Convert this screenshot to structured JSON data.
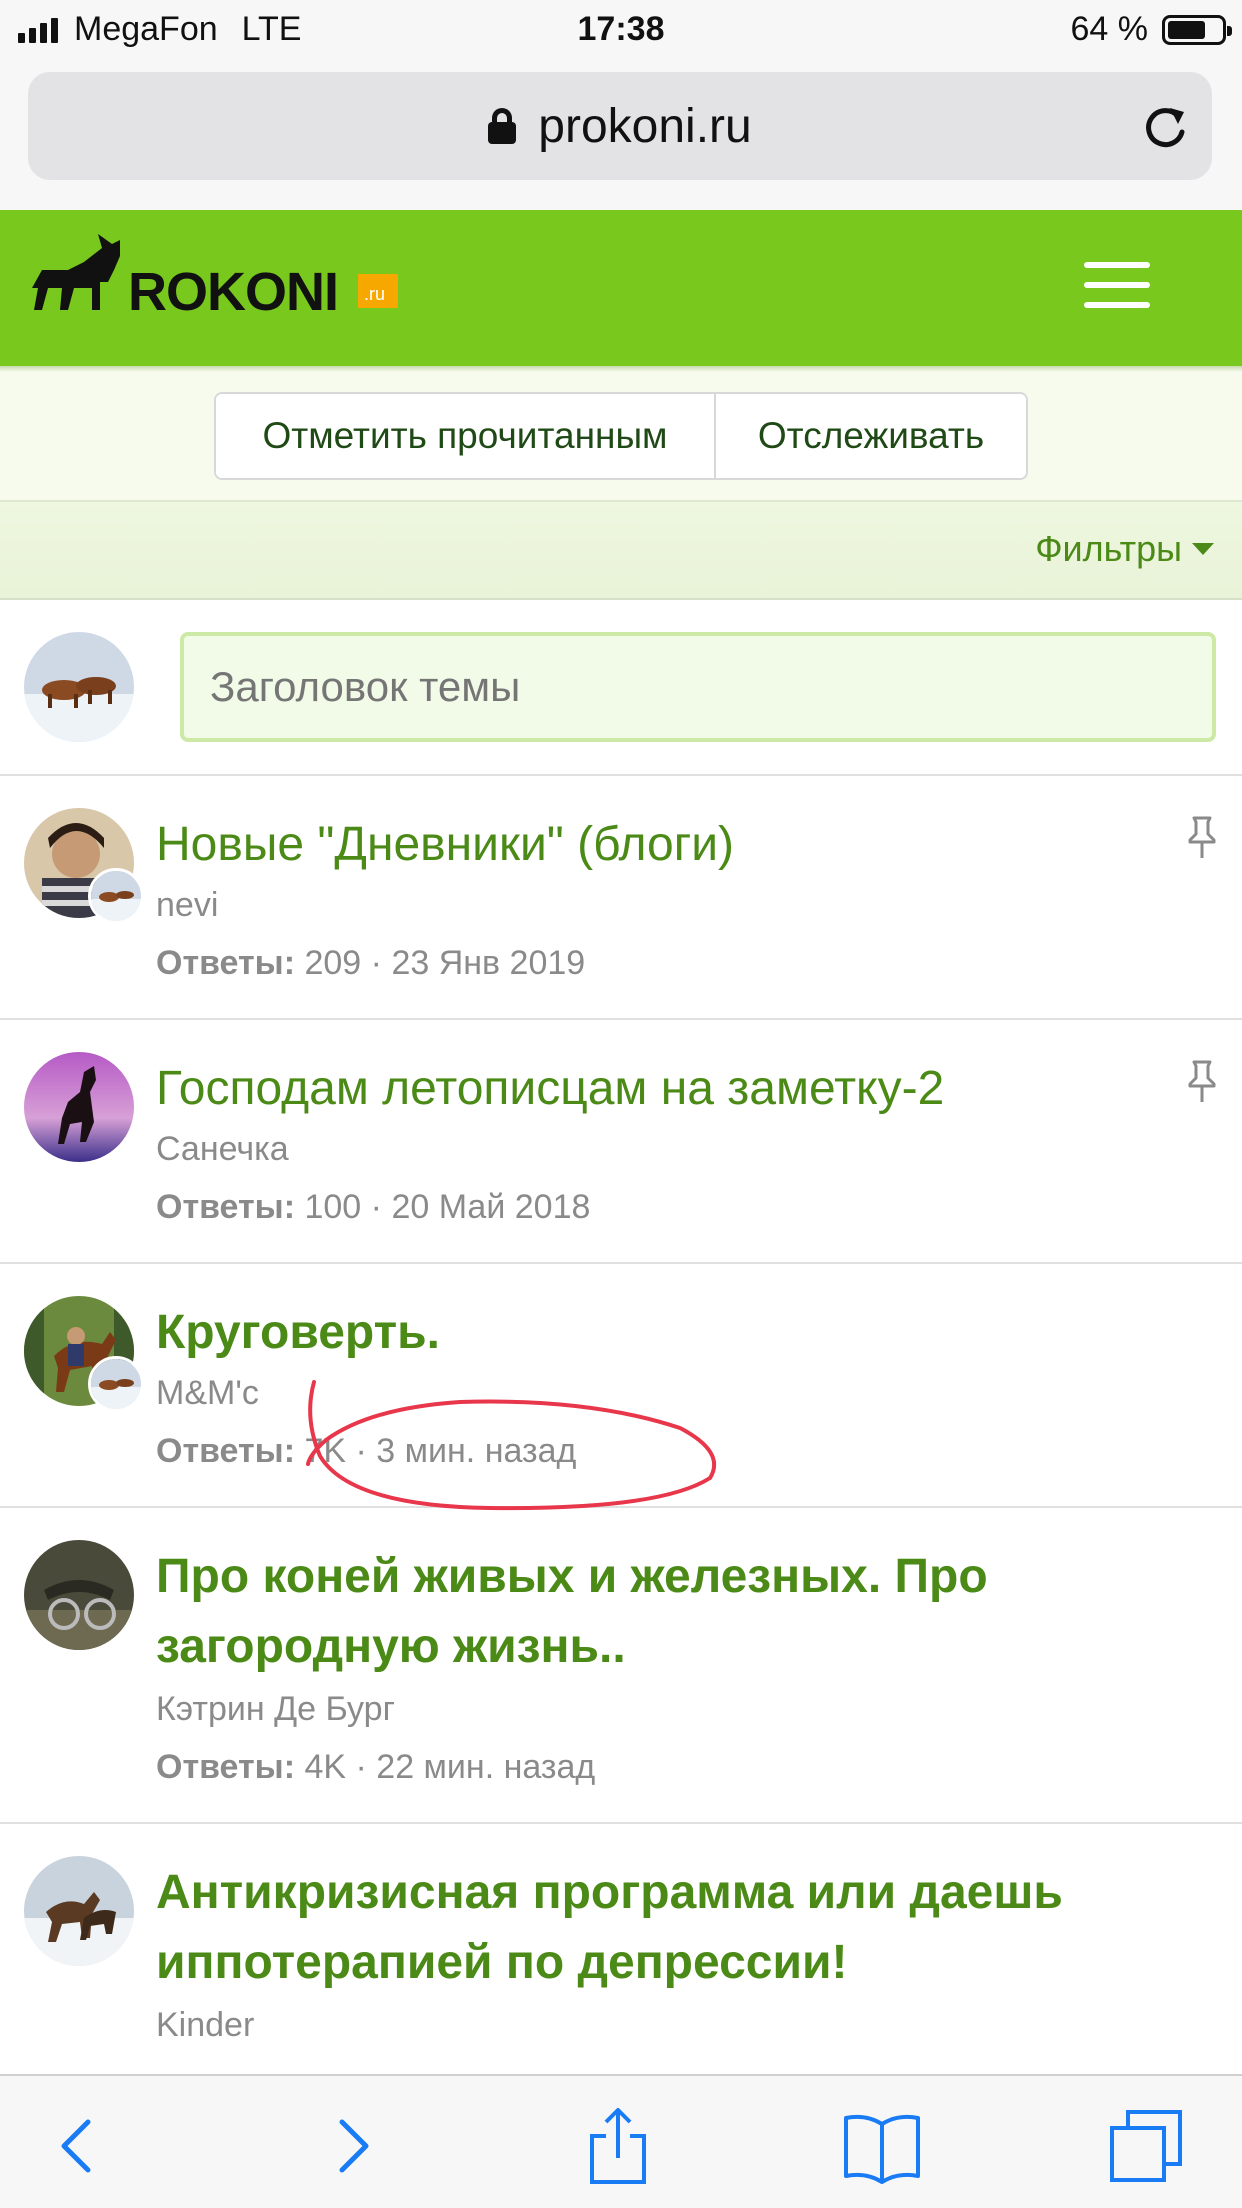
{
  "status_bar": {
    "carrier": "MegaFon",
    "network": "LTE",
    "time": "17:38",
    "battery": "64 %",
    "battery_level": 0.64
  },
  "browser": {
    "url": "prokoni.ru"
  },
  "site": {
    "logo_alt": "PROKONI.ru",
    "brand_color": "#78c81e"
  },
  "actions": {
    "mark_read": "Отметить прочитанным",
    "watch": "Отслеживать"
  },
  "filters": {
    "label": "Фильтры"
  },
  "new_thread": {
    "placeholder": "Заголовок темы"
  },
  "threads": [
    {
      "title": "Новые \"Дневники\" (блоги)",
      "author": "nevi",
      "replies_label": "Ответы:",
      "replies": "209",
      "date": "23 Янв 2019",
      "pinned": true,
      "unread": false
    },
    {
      "title": "Господам летописцам на заметку-2",
      "author": "Санечка",
      "replies_label": "Ответы:",
      "replies": "100",
      "date": "20 Май 2018",
      "pinned": true,
      "unread": false
    },
    {
      "title": "Круговерть.",
      "author": "M&M'c",
      "replies_label": "Ответы:",
      "replies": "7K",
      "date": "3 мин. назад",
      "pinned": false,
      "unread": true
    },
    {
      "title": "Про коней живых и железных. Про загородную жизнь..",
      "author": "Кэтрин Де Бург",
      "replies_label": "Ответы:",
      "replies": "4K",
      "date": "22 мин. назад",
      "pinned": false,
      "unread": true
    },
    {
      "title": "Антикризисная программа или даешь иппотерапией по депрессии!",
      "author": "Kinder",
      "pinned": false,
      "unread": true
    }
  ],
  "toolbar": {
    "icons": [
      "back-icon",
      "forward-icon",
      "share-icon",
      "bookmarks-icon",
      "tabs-icon"
    ],
    "accent": "#1a7cf5"
  }
}
